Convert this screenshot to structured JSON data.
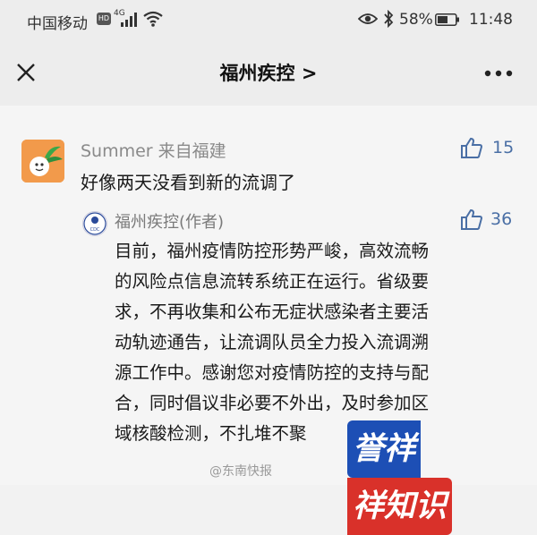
{
  "status_bar": {
    "carrier": "中国移动",
    "hd_badge": "HD",
    "network": "4G",
    "battery": "58%",
    "time": "11:48",
    "icons": [
      "signal-icon",
      "wifi-icon",
      "eye-icon",
      "bluetooth-icon",
      "battery-icon"
    ]
  },
  "header": {
    "title": "福州疾控 >",
    "close_icon": "close-icon",
    "more_icon": "more-icon"
  },
  "comment": {
    "author": "Summer  来自福建",
    "likes": "15",
    "text": "好像两天没看到新的流调了"
  },
  "reply": {
    "author": "福州疾控(作者)",
    "avatar_label": "CDC",
    "likes": "36",
    "lines": [
      "目前，福州疫情防控形势严峻，高效流畅",
      "的风险点信息流转系统正在运行。省级要",
      "求，不再收集和公布无症状感染者主要活",
      "动轨迹通告，让流调队员全力投入流调溯",
      "源工作中。感谢您对疫情防控的支持与配",
      "合，同时倡议非必要不外出，及时参加区",
      "域核酸检测，不扎堆不聚"
    ]
  },
  "watermark": {
    "weibo": "@东南快报",
    "logo_part1": "誉祥",
    "logo_part2": "祥知识"
  },
  "colors": {
    "background": "#f5f5f5",
    "header_bg": "#ededed",
    "like_blue": "#4a6fa5",
    "logo_blue": "#1d4fb5",
    "logo_red": "#d9312a"
  }
}
